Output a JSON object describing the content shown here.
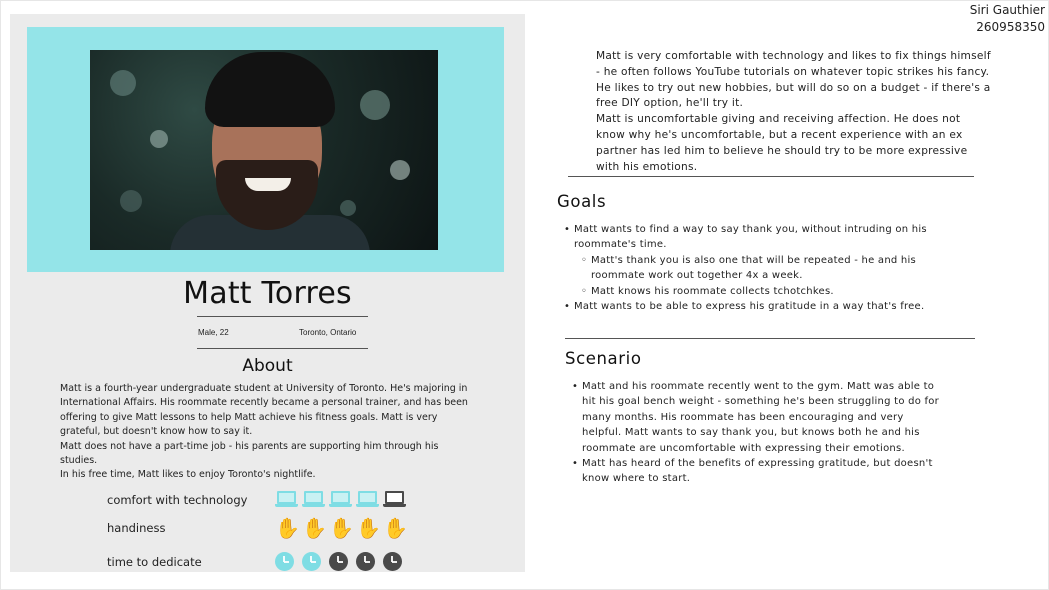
{
  "header": {
    "author": "Siri Gauthier",
    "student_id": "260958350"
  },
  "persona": {
    "name": "Matt Torres",
    "gender_age": "Male, 22",
    "location": "Toronto, Ontario",
    "about_title": "About",
    "about_paragraphs": [
      "Matt is a fourth-year undergraduate student at University of Toronto. He's majoring in International Affairs. His roommate recently became a personal trainer, and has been offering to give Matt lessons to help Matt achieve his fitness goals. Matt is very grateful, but doesn't know how to say it.",
      "Matt does not have a part-time job - his parents are supporting him through his studies.",
      "In his free time, Matt likes to enjoy Toronto's nightlife."
    ]
  },
  "meters": [
    {
      "label": "comfort with technology",
      "icon": "laptop-icon",
      "filled": 4,
      "total": 5
    },
    {
      "label": "handiness",
      "icon": "hand-icon",
      "filled": 5,
      "total": 5
    },
    {
      "label": "time to dedicate",
      "icon": "clock-icon",
      "filled": 2,
      "total": 5
    }
  ],
  "colors": {
    "accent": "#94e4e8",
    "accent_strong": "#7fdde4",
    "dark_icon": "#4a4a4a",
    "card_bg": "#ebebeb"
  },
  "intro": [
    "Matt is very comfortable with technology and likes to fix things himself - he often follows YouTube tutorials on whatever topic strikes his fancy. He likes to try out new hobbies, but will do so on a budget - if there's a free DIY option, he'll try it.",
    "Matt is uncomfortable giving and receiving affection. He does not know why he's uncomfortable, but a recent experience with an ex partner has led him to believe he should try to be more expressive with his emotions."
  ],
  "goals": {
    "title": "Goals",
    "items": [
      {
        "text": "Matt wants to find a way to say thank you, without intruding on his roommate's time.",
        "level": 1
      },
      {
        "text": "Matt's thank you is also one that will be repeated - he and his roommate work out together 4x a week.",
        "level": 2
      },
      {
        "text": "Matt knows his roommate collects tchotchkes.",
        "level": 2
      },
      {
        "text": "Matt wants to be able to express his gratitude in a way that's free.",
        "level": 1
      }
    ]
  },
  "scenario": {
    "title": "Scenario",
    "items": [
      {
        "text": "Matt and his roommate recently went to the gym. Matt was able to hit his goal bench weight - something he's been struggling to do for many months. His roommate has been encouraging and very helpful. Matt wants to say thank you, but knows both he and his roommate are uncomfortable with expressing their emotions.",
        "level": 1
      },
      {
        "text": "Matt has heard of the benefits of expressing gratitude, but doesn't know where to start.",
        "level": 1
      }
    ]
  }
}
